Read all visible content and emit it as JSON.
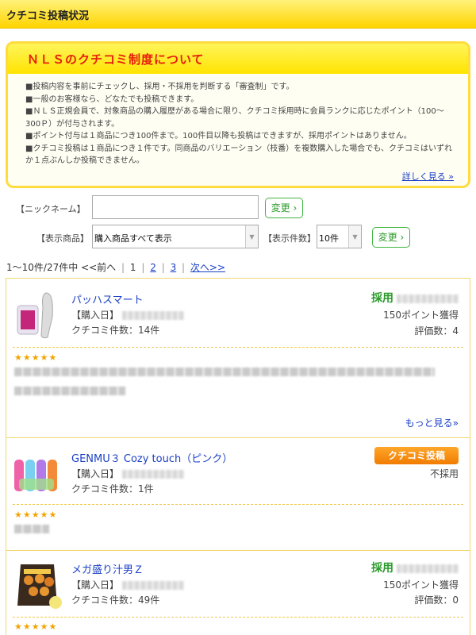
{
  "page_title": "クチコミ投稿状況",
  "about": {
    "heading": "ＮＬＳのクチコミ制度について",
    "items": [
      "■投稿内容を事前にチェックし、採用・不採用を判断する「審査制」です。",
      "■一般のお客様なら、どなたでも投稿できます。",
      "■ＮＬＳ正規会員で、対象商品の購入履歴がある場合に限り、クチコミ採用時に会員ランクに応じたポイント（100〜300Ｐ）が付与されます。",
      "■ポイント付与は１商品につき100件まで。100件目以降も投稿はできますが、採用ポイントはありません。",
      "■クチコミ投稿は１商品につき１件です。同商品のバリエーション（枝番）を複数購入した場合でも、クチコミはいずれか１点ぶんしか投稿できません。"
    ],
    "more_link": "詳しく見る »"
  },
  "filters": {
    "nickname_label": "【ニックネーム】",
    "nickname_value": "",
    "change_button": "変更 ›",
    "product_label": "【表示商品】",
    "product_value": "購入商品すべて表示",
    "count_label": "【表示件数】",
    "count_value": "10件",
    "change_button2": "変更 ›"
  },
  "pager": {
    "summary": "1〜10件/27件中",
    "prev": "<<前へ",
    "pages": [
      "1",
      "2",
      "3"
    ],
    "next": "次へ>>"
  },
  "reviews": [
    {
      "product": "パッハスマート",
      "purchase_label": "【購入日】",
      "count_text": "クチコミ件数：14件",
      "status": "採用",
      "points": "150ポイント獲得",
      "rating_count": "評価数：4",
      "stars": "★★★★★",
      "more": "もっと見る»"
    },
    {
      "product": "GENMU３ Cozy touch（ピンク）",
      "purchase_label": "【購入日】",
      "count_text": "クチコミ件数：1件",
      "post_button": "クチコミ投稿",
      "status": "不採用",
      "stars": "★★★★★"
    },
    {
      "product": "メガ盛り汁男Ｚ",
      "purchase_label": "【購入日】",
      "count_text": "クチコミ件数：49件",
      "status": "採用",
      "points": "150ポイント獲得",
      "rating_count": "評価数：0",
      "stars": "★★★★★"
    }
  ],
  "colors": {
    "accent_yellow": "#ffd400",
    "heading_red": "#e61e0b",
    "link_blue": "#1a3fc7",
    "adopt_green": "#2a9a2a",
    "post_orange": "#f07c00",
    "star": "#f2a500"
  },
  "icons": [
    "chevron-right-icon",
    "dropdown-arrow-icon",
    "star-icon"
  ]
}
